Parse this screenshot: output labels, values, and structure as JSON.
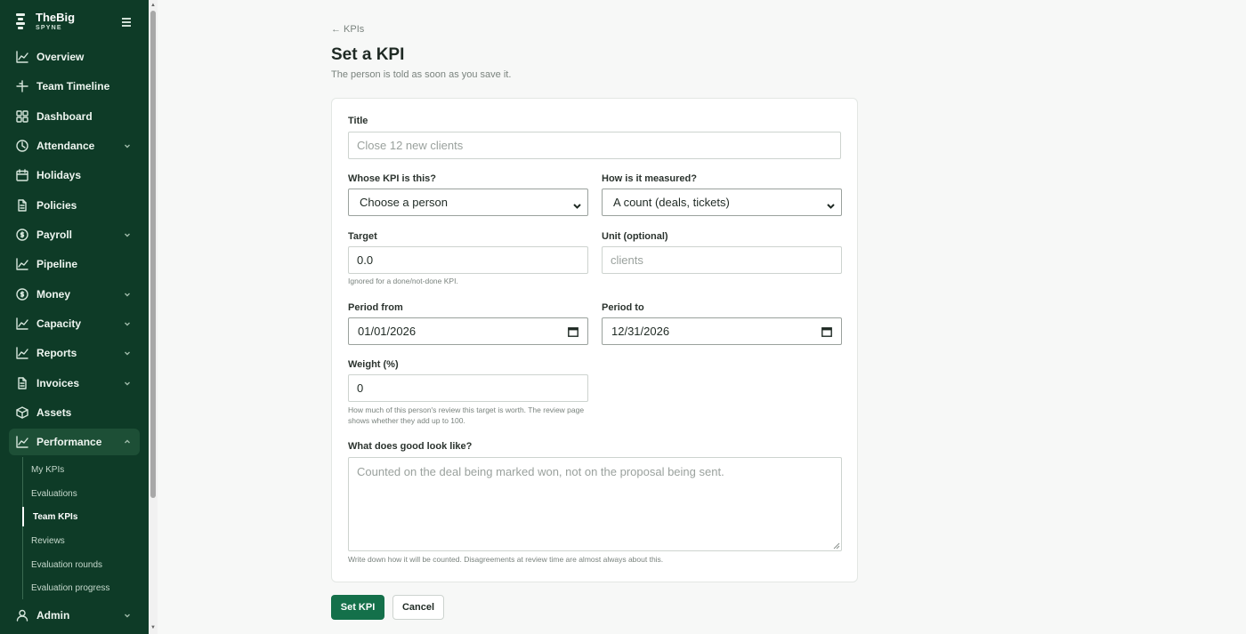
{
  "brand": {
    "name": "TheBig",
    "sub": "SPYNE"
  },
  "sidebar": {
    "items": [
      {
        "label": "Overview",
        "icon": "chart-line-icon"
      },
      {
        "label": "Team Timeline",
        "icon": "timeline-icon"
      },
      {
        "label": "Dashboard",
        "icon": "grid-icon"
      },
      {
        "label": "Attendance",
        "icon": "clock-icon"
      },
      {
        "label": "Holidays",
        "icon": "calendar-icon"
      },
      {
        "label": "Policies",
        "icon": "document-icon"
      },
      {
        "label": "Payroll",
        "icon": "coin-icon"
      },
      {
        "label": "Pipeline",
        "icon": "chart-line-icon"
      },
      {
        "label": "Money",
        "icon": "coin-icon"
      },
      {
        "label": "Capacity",
        "icon": "chart-line-icon"
      },
      {
        "label": "Reports",
        "icon": "chart-line-icon"
      },
      {
        "label": "Invoices",
        "icon": "document-icon"
      },
      {
        "label": "Assets",
        "icon": "box-icon"
      },
      {
        "label": "Performance",
        "icon": "chart-line-icon"
      },
      {
        "label": "Admin",
        "icon": "user-icon"
      }
    ],
    "performance_sub": [
      {
        "label": "My KPIs"
      },
      {
        "label": "Evaluations"
      },
      {
        "label": "Team KPIs"
      },
      {
        "label": "Reviews"
      },
      {
        "label": "Evaluation rounds"
      },
      {
        "label": "Evaluation progress"
      }
    ]
  },
  "page": {
    "back": "← KPIs",
    "title": "Set a KPI",
    "subtitle": "The person is told as soon as you save it."
  },
  "form": {
    "title_label": "Title",
    "title_placeholder": "Close 12 new clients",
    "whose_label": "Whose KPI is this?",
    "whose_value": "Choose a person",
    "measured_label": "How is it measured?",
    "measured_value": "A count (deals, tickets)",
    "target_label": "Target",
    "target_value": "0.0",
    "target_help": "Ignored for a done/not-done KPI.",
    "unit_label": "Unit (optional)",
    "unit_placeholder": "clients",
    "period_from_label": "Period from",
    "period_from_value": "01/01/2026",
    "period_to_label": "Period to",
    "period_to_value": "12/31/2026",
    "weight_label": "Weight (%)",
    "weight_value": "0",
    "weight_help": "How much of this person's review this target is worth. The review page shows whether they add up to 100.",
    "good_label": "What does good look like?",
    "good_placeholder": "Counted on the deal being marked won, not on the proposal being sent.",
    "good_help": "Write down how it will be counted. Disagreements at review time are almost always about this."
  },
  "actions": {
    "submit": "Set KPI",
    "cancel": "Cancel"
  },
  "colors": {
    "sidebar_bg": "#0e3b27",
    "primary": "#14704a"
  }
}
